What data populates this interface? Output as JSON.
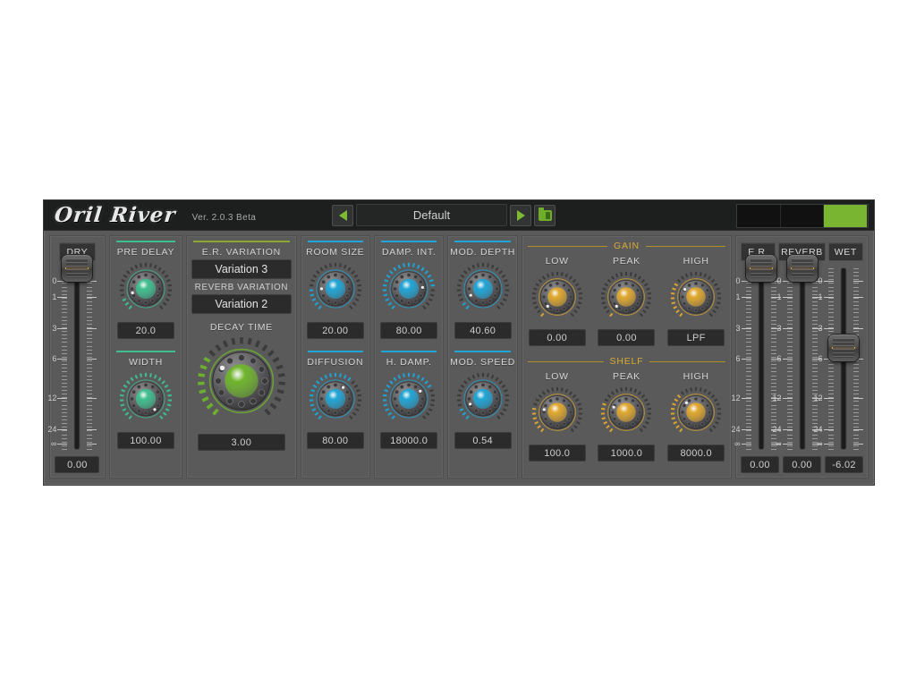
{
  "header": {
    "logo": "Oril River",
    "version": "Ver. 2.0.3 Beta",
    "preset_name": "Default",
    "prev_icon": "triangle-left-icon",
    "next_icon": "triangle-right-icon",
    "folder_icon": "folder-open-icon",
    "meter_segments_on": 2
  },
  "colors": {
    "green": "#3fbf8f",
    "blue": "#1fa5d6",
    "amber": "#e0a82e",
    "decay_green": "#6fb52c",
    "panel": "#5a5a5b",
    "header": "#1d1f1e"
  },
  "dry": {
    "button_label": "DRY",
    "value": "0.00",
    "scale": [
      "0",
      "1",
      "3",
      "6",
      "12",
      "24",
      "∞"
    ],
    "position_pct": 0
  },
  "pre_delay": {
    "label": "PRE DELAY",
    "value": "20.0",
    "arc_pct": 12
  },
  "width": {
    "label": "WIDTH",
    "value": "100.00",
    "arc_pct": 100
  },
  "variations": {
    "er_label": "E.R. VARIATION",
    "er_value": "Variation 3",
    "reverb_label": "REVERB VARIATION",
    "reverb_value": "Variation 2",
    "decay_label": "DECAY TIME",
    "decay_value": "3.00",
    "decay_arc_pct": 30
  },
  "reverb_knobs": [
    {
      "label": "ROOM SIZE",
      "value": "20.00",
      "arc_pct": 18
    },
    {
      "label": "DAMP. INT.",
      "value": "80.00",
      "arc_pct": 80
    },
    {
      "label": "MOD. DEPTH",
      "value": "40.60",
      "arc_pct": 8
    },
    {
      "label": "DIFFUSION",
      "value": "80.00",
      "arc_pct": 62
    },
    {
      "label": "H. DAMP.",
      "value": "18000.0",
      "arc_pct": 70
    },
    {
      "label": "MOD. SPEED",
      "value": "0.54",
      "arc_pct": 10
    }
  ],
  "eq": {
    "gain_title": "GAIN",
    "shelf_title": "SHELF",
    "gain": [
      {
        "label": "LOW",
        "value": "0.00",
        "arc_pct": 2
      },
      {
        "label": "PEAK",
        "value": "0.00",
        "arc_pct": 2
      },
      {
        "label": "HIGH",
        "value": "LPF",
        "arc_pct": 30
      }
    ],
    "shelf": [
      {
        "label": "LOW",
        "value": "100.0",
        "arc_pct": 22
      },
      {
        "label": "PEAK",
        "value": "1000.0",
        "arc_pct": 26
      },
      {
        "label": "HIGH",
        "value": "8000.0",
        "arc_pct": 34
      }
    ]
  },
  "output": {
    "buttons": [
      "E.R.",
      "REVERB",
      "WET"
    ],
    "faders": [
      {
        "name": "E.R.",
        "value": "0.00",
        "position_pct": 0
      },
      {
        "name": "REVERB",
        "value": "0.00",
        "position_pct": 0
      },
      {
        "name": "WET",
        "value": "-6.02",
        "position_pct": 41
      }
    ],
    "scale": [
      "0",
      "1",
      "3",
      "6",
      "12",
      "24",
      "∞"
    ]
  }
}
